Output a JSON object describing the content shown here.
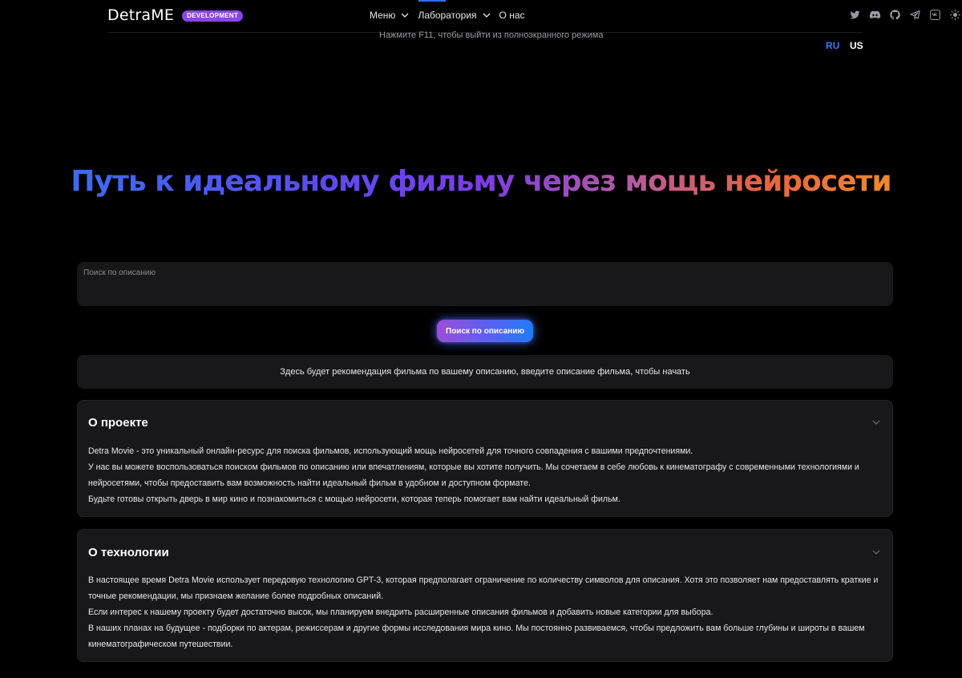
{
  "header": {
    "logo": "DetraME",
    "badge": "DEVELOPMENT",
    "nav": [
      {
        "label": "Меню"
      },
      {
        "label": "Лаборатория"
      },
      {
        "label": "О нас"
      }
    ],
    "fullscreen_note": "Нажмите F11, чтобы выйти из полноэкранного режима",
    "socials": [
      "twitter-icon",
      "discord-icon",
      "github-icon",
      "telegram-icon",
      "vk-icon",
      "sun-icon"
    ],
    "languages": {
      "ru": "RU",
      "us": "US"
    }
  },
  "hero": {
    "title": "Путь к идеальному фильму через мощь нейросети"
  },
  "search": {
    "placeholder": "Поиск по описанию",
    "button": "Поиск по описанию"
  },
  "recommendation": {
    "text": "Здесь будет рекомендация фильма по вашему описанию, введите описание фильма, чтобы начать"
  },
  "sections": {
    "about": {
      "title": "О проекте",
      "paragraphs": [
        "Detra Movie - это уникальный онлайн-ресурс для поиска фильмов, использующий мощь нейросетей для точного совпадения с вашими предпочтениями.",
        "У нас вы можете воспользоваться поиском фильмов по описанию или впечатлениям, которые вы хотите получить. Мы сочетаем в себе любовь к кинематографу с современными технологиями и нейросетями, чтобы предоставить вам возможность найти идеальный фильм в удобном и доступном формате.",
        "Будьте готовы открыть дверь в мир кино и познакомиться с мощью нейросети, которая теперь помогает вам найти идеальный фильм."
      ]
    },
    "tech": {
      "title": "О технологии",
      "paragraphs": [
        "В настоящее время Detra Movie использует передовую технологию GPT-3, которая предполагает ограничение по количеству символов для описания. Хотя это позволяет нам предоставлять краткие и точные рекомендации, мы признаем желание более подробных описаний.",
        "Если интерес к нашему проекту будет достаточно высок, мы планируем внедрить расширенные описания фильмов и добавить новые категории для выбора.",
        "В наших планах на будущее - подборки по актерам, режиссерам и другие формы исследования мира кино. Мы постоянно развиваемся, чтобы предложить вам больше глубины и широты в вашем кинематографическом путешествии."
      ]
    }
  },
  "colors": {
    "background": "#000000",
    "card": "#18181b",
    "badge": "#8b45e6",
    "accent_blue": "#2f7bff",
    "gradient_start": "#3b6cf2",
    "gradient_mid": "#7b3de8",
    "gradient_end": "#f08a2a"
  }
}
